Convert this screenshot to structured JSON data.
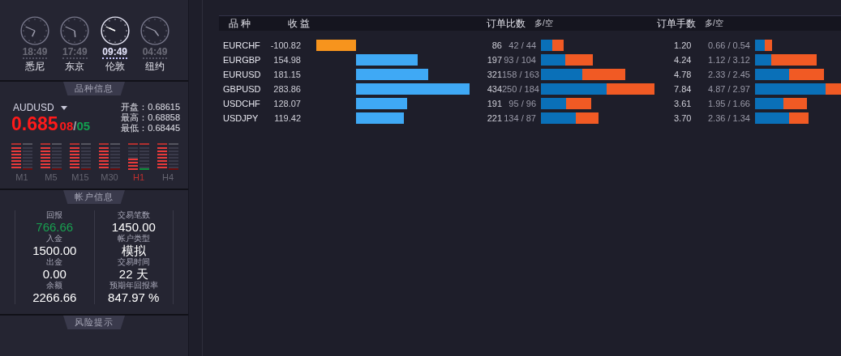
{
  "clocks": [
    {
      "time": "18:49",
      "city": "悉尼",
      "selected": false
    },
    {
      "time": "17:49",
      "city": "东京",
      "selected": false
    },
    {
      "time": "09:49",
      "city": "伦敦",
      "selected": true
    },
    {
      "time": "04:49",
      "city": "纽约",
      "selected": false
    }
  ],
  "symbol_info": {
    "title": "品种信息",
    "symbol": "AUDUSD",
    "price_main": "0.685",
    "price_a": "08",
    "price_sep": "/",
    "price_b": "05",
    "stats": [
      {
        "label": "开盘：",
        "value": "0.68615"
      },
      {
        "label": "最高：",
        "value": "0.68858"
      },
      {
        "label": "最低：",
        "value": "0.68445"
      }
    ],
    "timeframes": [
      {
        "label": "M1",
        "level": 1,
        "alert": false
      },
      {
        "label": "M5",
        "level": 1,
        "alert": false
      },
      {
        "label": "M15",
        "level": 1,
        "alert": false
      },
      {
        "label": "M30",
        "level": 1,
        "alert": false
      },
      {
        "label": "H1",
        "level": 0.5,
        "alert": true
      },
      {
        "label": "H4",
        "level": 1,
        "alert": false
      }
    ]
  },
  "account_info": {
    "title": "帐户信息",
    "left": [
      {
        "label": "回报",
        "value": "766.66",
        "highlight": true
      },
      {
        "label": "入金",
        "value": "1500.00",
        "highlight": false
      },
      {
        "label": "出金",
        "value": "0.00",
        "highlight": false
      },
      {
        "label": "余额",
        "value": "2266.66",
        "highlight": false
      }
    ],
    "right": [
      {
        "label": "交易笔数",
        "value": "1450.00",
        "highlight": false
      },
      {
        "label": "帐户类型",
        "value": "模拟",
        "highlight": false
      },
      {
        "label": "交易时间",
        "value": "22 天",
        "highlight": false
      },
      {
        "label": "预期年回报率",
        "value": "847.97 %",
        "highlight": false
      }
    ]
  },
  "risk": {
    "title": "风险提示"
  },
  "table": {
    "columns": [
      {
        "label": "品 种"
      },
      {
        "label": "收 益"
      },
      {
        "label": "订单比数",
        "sub": "多/空"
      },
      {
        "label": "订单手数",
        "sub": "多/空"
      }
    ],
    "rows": [
      {
        "symbol": "EURCHF",
        "profit": "-100.82",
        "orders": "86",
        "orders_split": "42 / 44",
        "lots": "1.20",
        "lots_split": "0.66 / 0.54"
      },
      {
        "symbol": "EURGBP",
        "profit": "154.98",
        "orders": "197",
        "orders_split": "93 / 104",
        "lots": "4.24",
        "lots_split": "1.12 / 3.12"
      },
      {
        "symbol": "EURUSD",
        "profit": "181.15",
        "orders": "321",
        "orders_split": "158 / 163",
        "lots": "4.78",
        "lots_split": "2.33 / 2.45"
      },
      {
        "symbol": "GBPUSD",
        "profit": "283.86",
        "orders": "434",
        "orders_split": "250 / 184",
        "lots": "7.84",
        "lots_split": "4.87 / 2.97"
      },
      {
        "symbol": "USDCHF",
        "profit": "128.07",
        "orders": "191",
        "orders_split": "95 / 96",
        "lots": "3.61",
        "lots_split": "1.95 / 1.66"
      },
      {
        "symbol": "USDJPY",
        "profit": "119.42",
        "orders": "221",
        "orders_split": "134 / 87",
        "lots": "3.70",
        "lots_split": "2.36 / 1.34"
      }
    ]
  }
}
